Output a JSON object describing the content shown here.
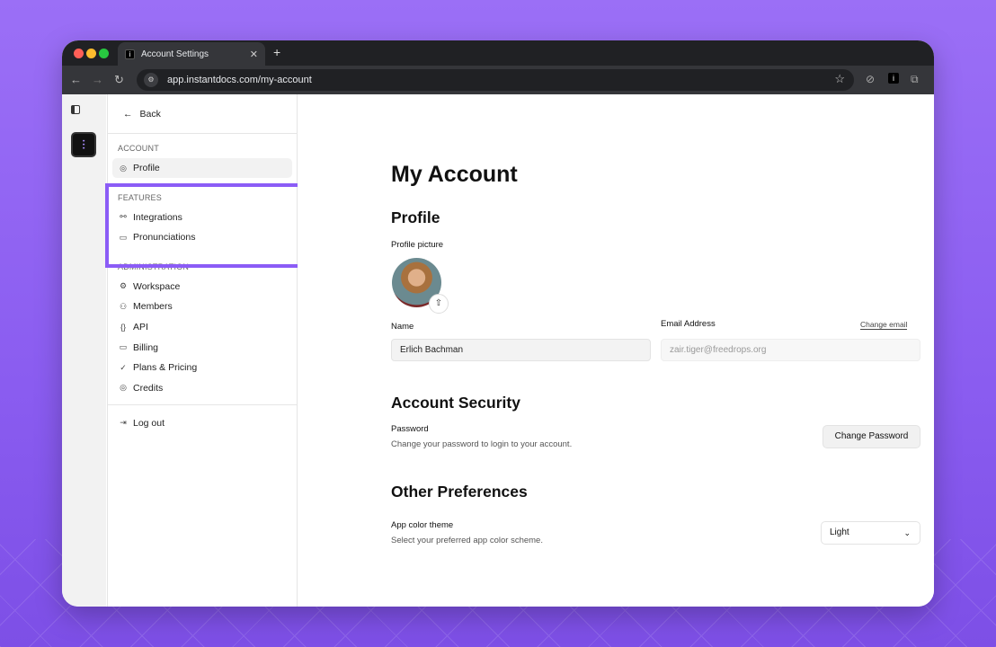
{
  "browser": {
    "tab_title": "Account Settings",
    "url": "app.instantdocs.com/my-account",
    "colors": {
      "close": "#ff5f57",
      "minimize": "#febc2e",
      "maximize": "#28c840"
    }
  },
  "sidebar": {
    "back": "Back",
    "sections": [
      {
        "title": "ACCOUNT",
        "items": [
          {
            "label": "Profile",
            "icon": "user-circle-icon",
            "active": true
          }
        ]
      },
      {
        "title": "FEATURES",
        "items": [
          {
            "label": "Integrations",
            "icon": "integrations-icon"
          },
          {
            "label": "Pronunciations",
            "icon": "message-square-icon"
          }
        ]
      },
      {
        "title": "ADMINISTRATION",
        "items": [
          {
            "label": "Workspace",
            "icon": "gear-icon"
          },
          {
            "label": "Members",
            "icon": "users-icon"
          },
          {
            "label": "API",
            "icon": "braces-icon"
          },
          {
            "label": "Billing",
            "icon": "credit-card-icon"
          },
          {
            "label": "Plans & Pricing",
            "icon": "check-circle-icon"
          },
          {
            "label": "Credits",
            "icon": "coins-icon"
          }
        ]
      }
    ],
    "logout": "Log out"
  },
  "highlight_color": "#8b5cf6",
  "main": {
    "title": "My Account",
    "profile": {
      "heading": "Profile",
      "picture_label": "Profile picture",
      "name_label": "Name",
      "name_value": "Erlich Bachman",
      "email_label": "Email Address",
      "email_placeholder": "zair.tiger@freedrops.org",
      "change_email": "Change email"
    },
    "security": {
      "heading": "Account Security",
      "password_label": "Password",
      "password_desc": "Change your password to login to your account.",
      "change_password": "Change Password"
    },
    "preferences": {
      "heading": "Other Preferences",
      "theme_label": "App color theme",
      "theme_desc": "Select your preferred app color scheme.",
      "theme_value": "Light"
    }
  }
}
